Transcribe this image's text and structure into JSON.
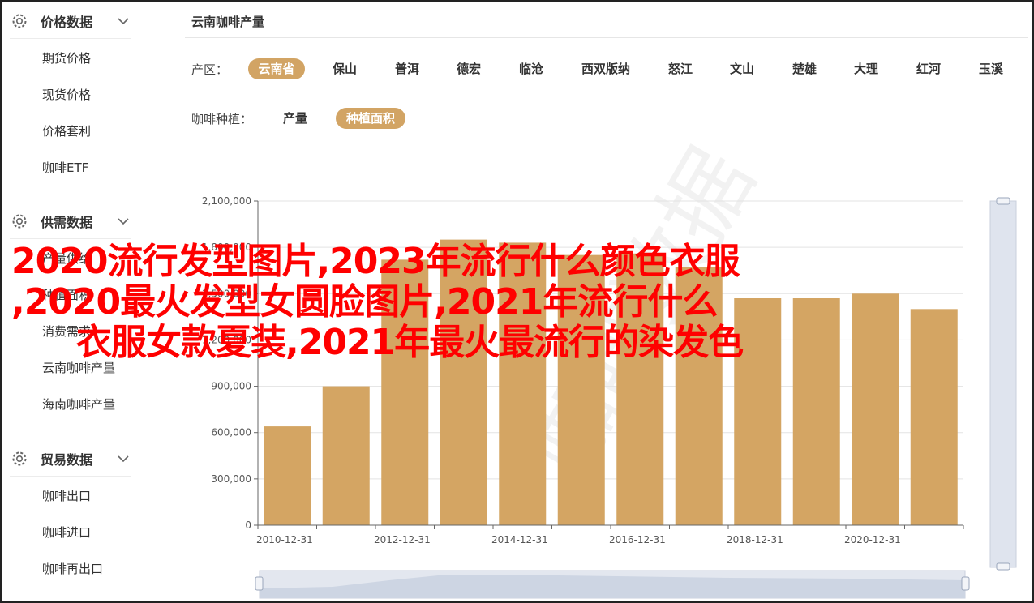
{
  "sidebar": {
    "groups": [
      {
        "title": "价格数据",
        "items": [
          "期货价格",
          "现货价格",
          "价格套利",
          "咖啡ETF"
        ]
      },
      {
        "title": "供需数据",
        "items": [
          "产量供给",
          "种植面积",
          "消费需求",
          "云南咖啡产量",
          "海南咖啡产量"
        ]
      },
      {
        "title": "贸易数据",
        "items": [
          "咖啡出口",
          "咖啡进口",
          "咖啡再出口"
        ]
      }
    ]
  },
  "main": {
    "title": "云南咖啡产量",
    "region_label": "产区：",
    "regions": [
      "云南省",
      "保山",
      "普洱",
      "德宏",
      "临沧",
      "西双版纳",
      "怒江",
      "文山",
      "楚雄",
      "大理",
      "红河",
      "玉溪"
    ],
    "active_region": "云南省",
    "metric_label": "咖啡种植：",
    "metrics": [
      "产量",
      "种植面积"
    ],
    "active_metric": "种植面积"
  },
  "watermark": "咖啡数据",
  "overlay": {
    "line1": "2020流行发型图片,2023年流行什么颜色衣服",
    "line2": ",2020最火发型女圆脸图片,2021年流行什么",
    "line3": "衣服女款夏装,2021年最火最流行的染发色"
  },
  "colors": {
    "bar": "#d4a563",
    "chip_active": "#d2a464",
    "overlay_text": "#ff0000"
  },
  "chart_data": {
    "type": "bar",
    "x": [
      "2010-12-31",
      "2011-12-31",
      "2012-12-31",
      "2013-12-31",
      "2014-12-31",
      "2015-12-31",
      "2016-12-31",
      "2017-12-31",
      "2018-12-31",
      "2019-12-31",
      "2020-12-31",
      "2021-12-31"
    ],
    "x_tick_labels": [
      "2010-12-31",
      "2012-12-31",
      "2014-12-31",
      "2016-12-31",
      "2018-12-31",
      "2020-12-31"
    ],
    "values": [
      640000,
      900000,
      1720000,
      1850000,
      1830000,
      1750000,
      1760000,
      1670000,
      1470000,
      1470000,
      1500000,
      1400000
    ],
    "y_ticks": [
      "0",
      "300,000",
      "600,000",
      "900,000",
      "1,200,000",
      "1,500,000",
      "1,800,000",
      "2,100,000"
    ],
    "ylim": [
      0,
      2100000
    ],
    "grid": true
  }
}
